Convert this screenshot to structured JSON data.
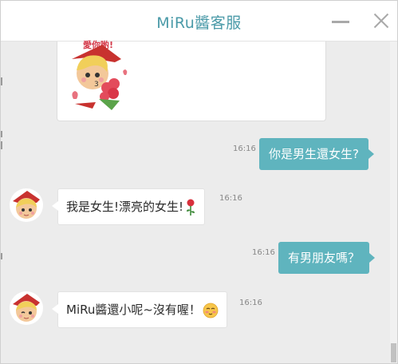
{
  "window": {
    "title": "MiRu醬客服"
  },
  "messages": [
    {
      "time": "16:16",
      "text": "你是男生還女生?"
    },
    {
      "time": "16:16",
      "text": "我是女生!漂亮的女生!"
    },
    {
      "time": "16:16",
      "text": "有男朋友嗎？"
    },
    {
      "time": "16:16",
      "text": "MiRu醬還小呢~沒有喔！"
    }
  ],
  "sticker": {
    "caption": "愛你喲!"
  },
  "icons": {
    "rose": "rose-icon",
    "blush": "blush-emoji-icon",
    "minimize": "minimize-icon",
    "close": "close-icon"
  },
  "colors": {
    "accent": "#5fb4be",
    "title": "#4a9aa8",
    "background": "#ececec"
  }
}
